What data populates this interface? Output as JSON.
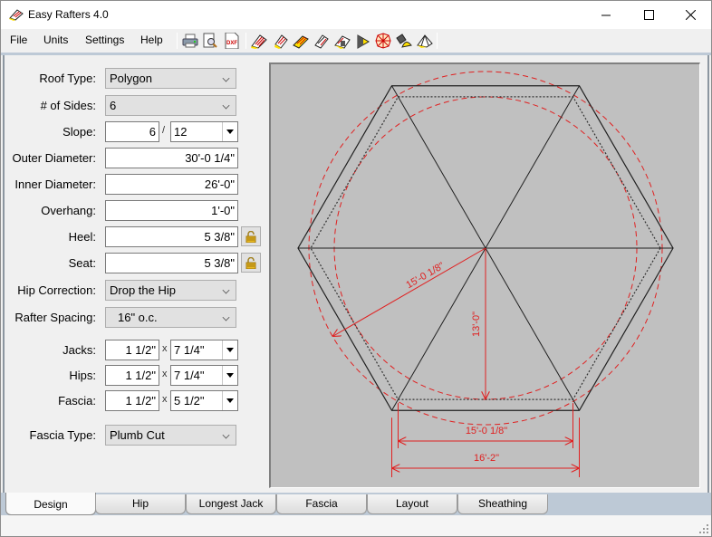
{
  "window": {
    "title": "Easy Rafters 4.0",
    "controls": [
      "minimize",
      "maximize",
      "close"
    ]
  },
  "menu": {
    "items": [
      "File",
      "Units",
      "Settings",
      "Help"
    ]
  },
  "toolbar": {
    "icons": [
      "print-icon",
      "print-preview-icon",
      "dxf-export-icon",
      "gable-roof-icon",
      "hip-roof-icon",
      "shed-roof-icon",
      "dutch-hip-icon",
      "valley-roof-icon",
      "triangle-roof-icon",
      "polygon-roof-icon",
      "turret-roof-icon",
      "gazebo-roof-icon"
    ],
    "dxf_label": "DXF"
  },
  "form": {
    "roof_type": {
      "label": "Roof Type:",
      "value": "Polygon"
    },
    "sides": {
      "label": "# of Sides:",
      "value": "6"
    },
    "slope": {
      "label": "Slope:",
      "rise": "6",
      "separator": "/",
      "run": "12"
    },
    "outer_diameter": {
      "label": "Outer Diameter:",
      "value": "30'-0 1/4\""
    },
    "inner_diameter": {
      "label": "Inner Diameter:",
      "value": "26'-0\""
    },
    "overhang": {
      "label": "Overhang:",
      "value": "1'-0\""
    },
    "heel": {
      "label": "Heel:",
      "value": "5 3/8\"",
      "lock": "unlocked"
    },
    "seat": {
      "label": "Seat:",
      "value": "5 3/8\"",
      "lock": "unlocked"
    },
    "hip_correction": {
      "label": "Hip Correction:",
      "value": "Drop the Hip"
    },
    "rafter_spacing": {
      "label": "Rafter Spacing:",
      "value": "16\" o.c."
    },
    "jacks": {
      "label": "Jacks:",
      "thickness": "1 1/2\"",
      "x": "x",
      "depth": "7 1/4\""
    },
    "hips": {
      "label": "Hips:",
      "thickness": "1 1/2\"",
      "x": "x",
      "depth": "7 1/4\""
    },
    "fascia": {
      "label": "Fascia:",
      "thickness": "1 1/2\"",
      "x": "x",
      "depth": "5 1/2\""
    },
    "fascia_type": {
      "label": "Fascia Type:",
      "value": "Plumb Cut"
    }
  },
  "drawing": {
    "shape": "hexagon",
    "sides": 6,
    "dimensions": {
      "radius_outer": "15'-0 1/8\"",
      "radius_inner": "13'-0\"",
      "side_inner": "15'-0 1/8\"",
      "side_outer": "16'-2\""
    },
    "colors": {
      "background": "#c0c0c0",
      "outline": "#202020",
      "dimension": "#e02020"
    }
  },
  "tabs": {
    "items": [
      "Design",
      "Hip",
      "Longest Jack",
      "Fascia",
      "Layout",
      "Sheathing"
    ],
    "active": "Design"
  }
}
